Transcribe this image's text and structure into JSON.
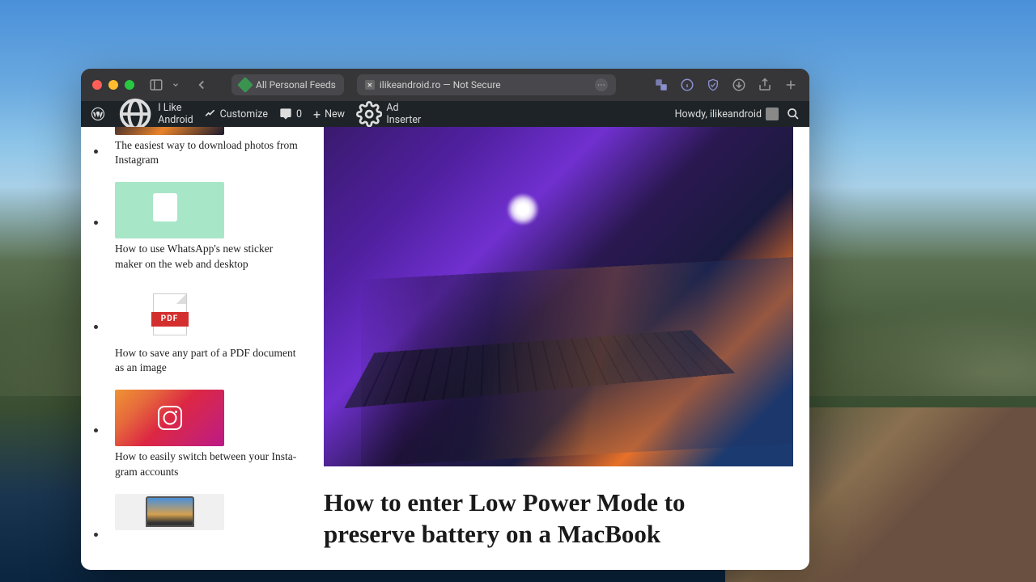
{
  "browser": {
    "feeds_label": "All Personal Feeds",
    "address": "ilikeandroid.ro — Not Secure"
  },
  "adminbar": {
    "site_name": "I Like Android",
    "customize": "Customize",
    "comments": "0",
    "new": "New",
    "ad_inserter": "Ad Inserter",
    "howdy": "Howdy, ilikeandroid"
  },
  "sidebar": {
    "items": [
      {
        "title": "The easiest way to download photos from Instagram"
      },
      {
        "title": "How to use WhatsApp's new sticker maker on the web and desktop"
      },
      {
        "title": "How to save any part of a PDF document as an image"
      },
      {
        "title": "How to easily switch between your Insta­gram accounts"
      },
      {
        "title": ""
      }
    ]
  },
  "article": {
    "title": "How to enter Low Power Mode to preserve battery on a MacBook"
  },
  "pdf_label": "PDF"
}
